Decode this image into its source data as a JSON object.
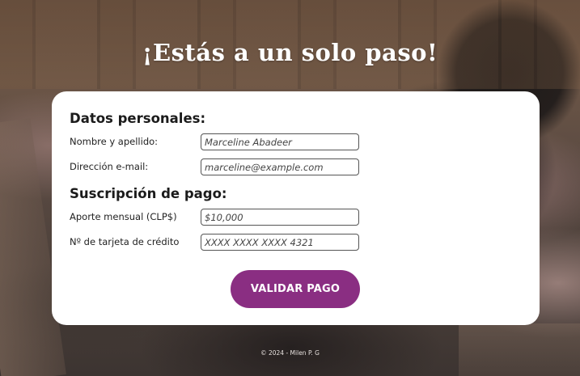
{
  "page": {
    "title": "¡Estás a un solo paso!",
    "footer": "© 2024 - Milen P. G"
  },
  "personal": {
    "heading": "Datos personales:",
    "name_label": "Nombre y apellido:",
    "name_value": "Marceline Abadeer",
    "email_label": "Dirección e-mail:",
    "email_value": "marceline@example.com"
  },
  "payment": {
    "heading": "Suscripción de pago:",
    "amount_label": "Aporte mensual (CLP$)",
    "amount_value": "$10,000",
    "card_label": "Nº de tarjeta de crédito",
    "card_value": "XXXX XXXX XXXX 4321"
  },
  "actions": {
    "submit_label": "VALIDAR PAGO"
  },
  "colors": {
    "accent": "#8a2e82",
    "card_bg": "#ffffff",
    "title_text": "#ffffff"
  }
}
